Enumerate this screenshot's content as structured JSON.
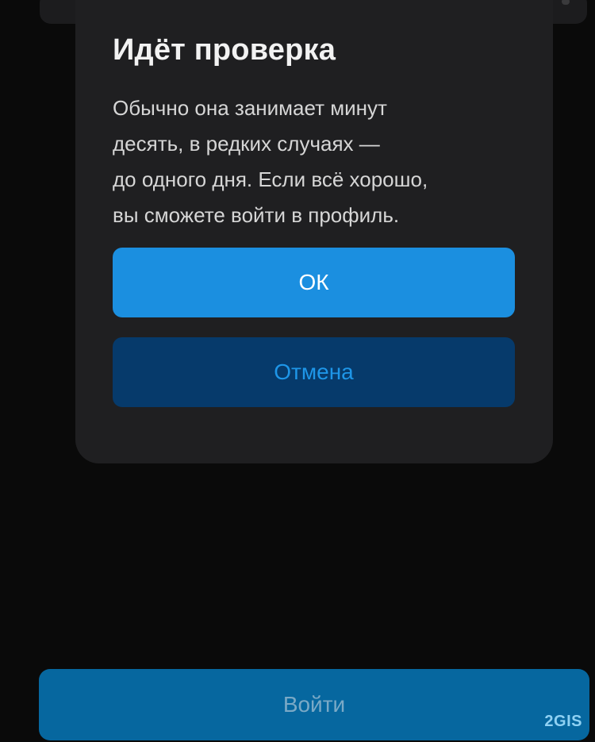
{
  "dialog": {
    "title": "Идёт проверка",
    "body_lines": [
      "Обычно она занимает минут",
      "десять, в редких случаях —",
      "до одного дня. Если всё хорошо,",
      "вы сможете войти в профиль."
    ],
    "ok_label": "ОК",
    "cancel_label": "Отмена"
  },
  "footer": {
    "login_label": "Войти"
  },
  "watermark": "2GIS",
  "colors": {
    "background": "#0a0a0a",
    "dialog_bg": "#1f1f21",
    "ok_button": "#1b8fe0",
    "cancel_button": "#063a6b",
    "cancel_text": "#1e96e8",
    "login_button": "#06679f"
  }
}
